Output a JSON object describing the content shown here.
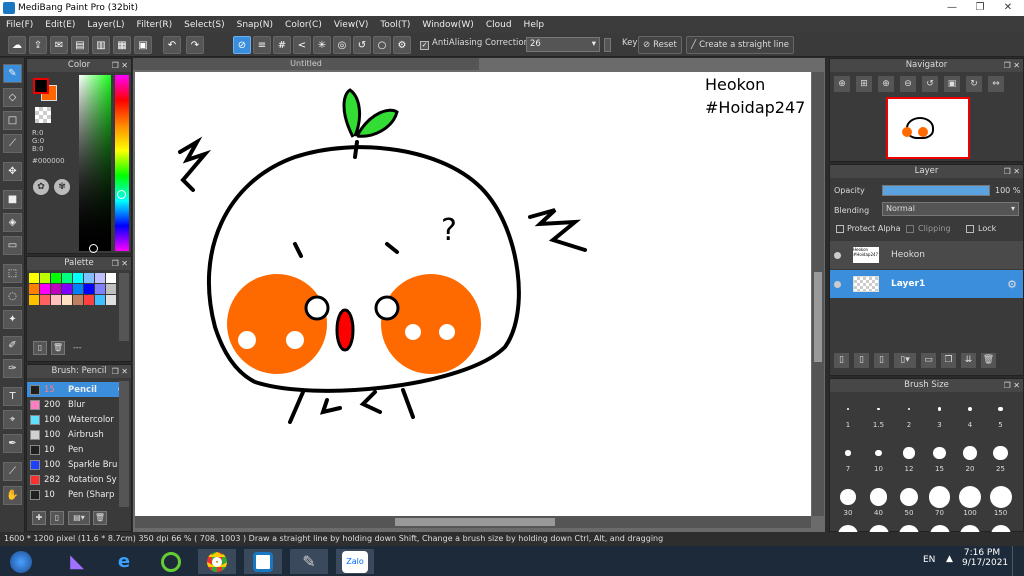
{
  "window": {
    "title": "MediBang Paint Pro (32bit)",
    "minimize": "—",
    "maximize": "❐",
    "close": "✕"
  },
  "menu": [
    "File(F)",
    "Edit(E)",
    "Layer(L)",
    "Filter(R)",
    "Select(S)",
    "Snap(N)",
    "Color(C)",
    "View(V)",
    "Tool(T)",
    "Window(W)",
    "Cloud",
    "Help"
  ],
  "toolbar": {
    "antialiasing_label": "AntiAliasing",
    "correction_label": "Correction",
    "correction_value": "26",
    "key_label": "Key",
    "reset_label": "Reset",
    "straight_line_label": "Create a straight line"
  },
  "color_panel": {
    "title": "Color",
    "r": "R:0",
    "g": "G:0",
    "b": "B:0",
    "hex": "#000000",
    "primary": "#000000",
    "secondary": "#ff6600"
  },
  "palette_panel": {
    "title": "Palette",
    "menu_label": "---",
    "swatches": [
      "#ffff00",
      "#c0ff00",
      "#00ff00",
      "#00ff80",
      "#00ffff",
      "#80c0ff",
      "#c0c0ff",
      "#ffffff",
      "#ff8000",
      "#ff00ff",
      "#c000c0",
      "#8000ff",
      "#0080ff",
      "#0000ff",
      "#8080ff",
      "#c0c0c0",
      "#ffc000",
      "#ff6060",
      "#ffc0c0",
      "#ffe0c0",
      "#c08060",
      "#ff4040",
      "#40c0ff",
      "#e0e0e0"
    ]
  },
  "brush_panel": {
    "title": "Brush: Pencil",
    "brushes": [
      {
        "size": "15",
        "name": "Pencil",
        "color": "#3b8edc"
      },
      {
        "size": "200",
        "name": "Blur",
        "color": "#ff80c0"
      },
      {
        "size": "100",
        "name": "Watercolor",
        "color": "#60e0ff"
      },
      {
        "size": "100",
        "name": "Airbrush",
        "color": "#d0d0d0"
      },
      {
        "size": "10",
        "name": "Pen",
        "color": "#202020"
      },
      {
        "size": "100",
        "name": "Sparkle Bru",
        "color": "#2040ff"
      },
      {
        "size": "282",
        "name": "Rotation Sy",
        "color": "#ff3030"
      },
      {
        "size": "10",
        "name": "Pen (Sharp",
        "color": "#202020"
      }
    ]
  },
  "canvas": {
    "tab_title": "Untitled",
    "text_line1": "Heokon",
    "text_line2": "#Hoidap247",
    "question": "?"
  },
  "navigator": {
    "title": "Navigator"
  },
  "layer_panel": {
    "title": "Layer",
    "opacity_label": "Opacity",
    "opacity_value": "100 %",
    "opacity_fraction": 1.0,
    "blending_label": "Blending",
    "blending_value": "Normal",
    "protect_alpha": "Protect Alpha",
    "clipping": "Clipping",
    "lock": "Lock",
    "layers": [
      {
        "name": "Heokon",
        "selected": false
      },
      {
        "name": "Layer1",
        "selected": true
      }
    ]
  },
  "brush_size_panel": {
    "title": "Brush Size",
    "sizes": [
      "1",
      "1.5",
      "2",
      "3",
      "4",
      "5",
      "7",
      "10",
      "12",
      "15",
      "20",
      "25",
      "30",
      "40",
      "50",
      "70",
      "100",
      "150"
    ]
  },
  "statusbar": {
    "size": "1600 * 1200 pixel",
    "cm": "(11.6 * 8.7cm)",
    "dpi": "350 dpi",
    "zoom": "66 %",
    "coords": "( 708, 1003 )",
    "hint": "Draw a straight line by holding down Shift, Change a brush size by holding down Ctrl, Alt, and dragging"
  },
  "taskbar": {
    "lang": "EN",
    "time": "7:16 PM",
    "date": "9/17/2021",
    "zalo": "Zalo"
  },
  "colors": {
    "accent": "#3b8edc",
    "orange": "#ff6a00",
    "leaf": "#33dd33"
  }
}
